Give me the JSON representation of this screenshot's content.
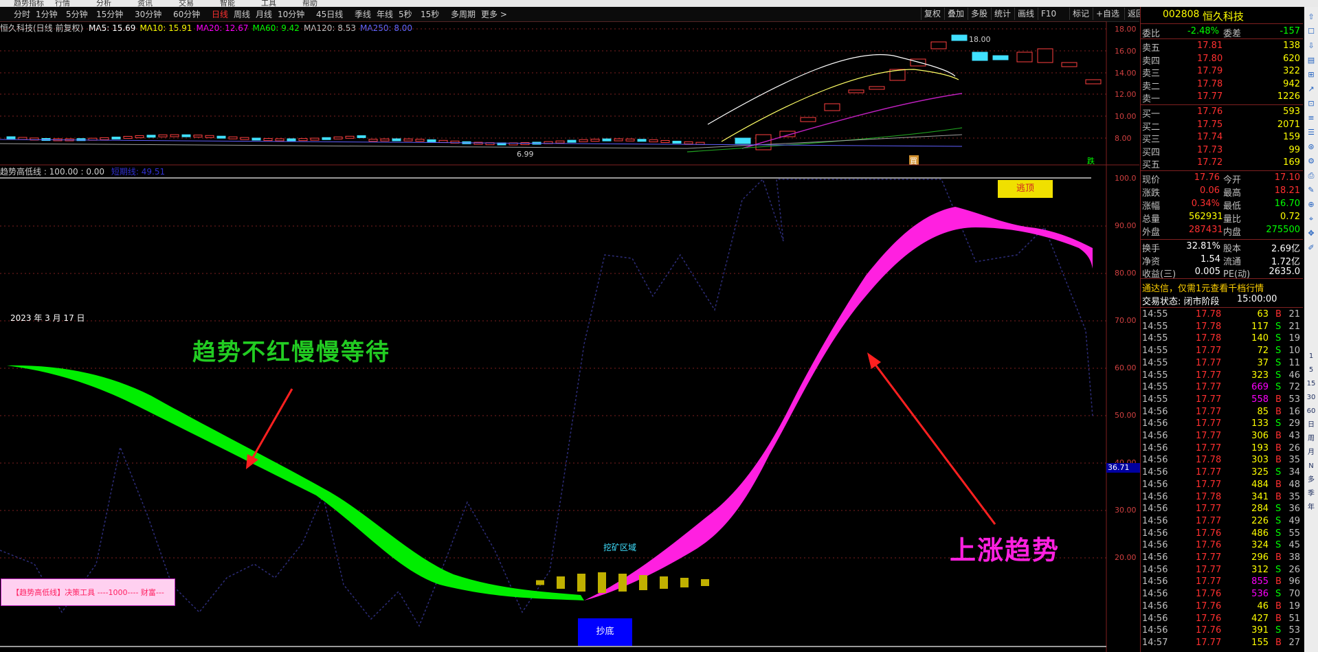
{
  "titlebar": {
    "items": [
      "趋势指标",
      "行情",
      "分析",
      "资讯",
      "交易",
      "智能",
      "工具",
      "帮助"
    ]
  },
  "toolbar": {
    "periods": [
      "分时",
      "1分钟",
      "5分钟",
      "15分钟",
      "30分钟",
      "60分钟",
      "日线",
      "周线",
      "月线",
      "10分钟",
      "45日线",
      "季线",
      "年线",
      "5秒",
      "15秒",
      "多周期",
      "更多 >"
    ],
    "active_period": "日线",
    "right_buttons": [
      "复权",
      "叠加",
      "多股",
      "统计",
      "画线",
      "F10",
      "标记",
      "+自选",
      "返回"
    ]
  },
  "main_chart": {
    "stock_label": "恒久科技(日线 前复权)",
    "ma_items": [
      {
        "label": "MA5: 15.69",
        "color": "#ffffff"
      },
      {
        "label": "MA10: 15.91",
        "color": "#ffff00"
      },
      {
        "label": "MA20: 12.67",
        "color": "#ff00ff"
      },
      {
        "label": "MA60: 9.42",
        "color": "#00ff00"
      },
      {
        "label": "MA120: 8.53",
        "color": "#c0c0c0"
      },
      {
        "label": "MA250: 8.00",
        "color": "#6666ff"
      }
    ],
    "price_axis": [
      "18.00",
      "16.00",
      "14.00",
      "12.00",
      "10.00",
      "8.00"
    ],
    "high_label": "18.00",
    "low_label": "6.99",
    "marker_buy": "買",
    "marker_sell": "跌"
  },
  "indicator": {
    "title": "趋势高低线 : 100.00 : 0.00",
    "extra": "短期线: 49.51",
    "axis": [
      "100.0",
      "90.00",
      "80.00",
      "70.00",
      "60.00",
      "50.00",
      "40.00",
      "30.00",
      "20.00"
    ],
    "current_value": "36.71",
    "date_label": "2023 年 3 月 17 日",
    "annotation_wait": "趋势不红慢慢等待",
    "annotation_up": "上涨趋势",
    "tag_escape": "逃顶",
    "tag_bottom": "抄底",
    "tag_mining": "挖矿区域",
    "footer_banner": "【趋势高低线】决策工具 ----1000---- 财富---"
  },
  "quote_panel": {
    "code": "002808",
    "name": "恒久科技",
    "weibi_label": "委比",
    "weibi_value": "-2.48%",
    "weicha_label": "委差",
    "weicha_value": "-157",
    "asks": [
      {
        "label": "卖五",
        "price": "17.81",
        "vol": "138"
      },
      {
        "label": "卖四",
        "price": "17.80",
        "vol": "620"
      },
      {
        "label": "卖三",
        "price": "17.79",
        "vol": "322"
      },
      {
        "label": "卖二",
        "price": "17.78",
        "vol": "942"
      },
      {
        "label": "卖一",
        "price": "17.77",
        "vol": "1226"
      }
    ],
    "bids": [
      {
        "label": "买一",
        "price": "17.76",
        "vol": "593"
      },
      {
        "label": "买二",
        "price": "17.75",
        "vol": "2071"
      },
      {
        "label": "买三",
        "price": "17.74",
        "vol": "159"
      },
      {
        "label": "买四",
        "price": "17.73",
        "vol": "99"
      },
      {
        "label": "买五",
        "price": "17.72",
        "vol": "169"
      }
    ],
    "stats": [
      {
        "l1": "现价",
        "v1": "17.76",
        "c1": "#ff3030",
        "l2": "今开",
        "v2": "17.10",
        "c2": "#ff3030"
      },
      {
        "l1": "涨跌",
        "v1": "0.06",
        "c1": "#ff3030",
        "l2": "最高",
        "v2": "18.21",
        "c2": "#ff3030"
      },
      {
        "l1": "涨幅",
        "v1": "0.34%",
        "c1": "#ff3030",
        "l2": "最低",
        "v2": "16.70",
        "c2": "#00ff00"
      },
      {
        "l1": "总量",
        "v1": "562931",
        "c1": "#ffff00",
        "l2": "量比",
        "v2": "0.72",
        "c2": "#ffff00"
      },
      {
        "l1": "外盘",
        "v1": "287431",
        "c1": "#ff3030",
        "l2": "内盘",
        "v2": "275500",
        "c2": "#00ff00"
      }
    ],
    "stats2": [
      {
        "l1": "换手",
        "v1": "32.81%",
        "l2": "股本",
        "v2": "2.69亿"
      },
      {
        "l1": "净资",
        "v1": "1.54",
        "l2": "流通",
        "v2": "1.72亿"
      },
      {
        "l1": "收益(三)",
        "v1": "0.005",
        "l2": "PE(动)",
        "v2": "2635.0"
      }
    ],
    "promo": "通达信，仅需1元查看千档行情",
    "trade_status_label": "交易状态: 闭市阶段",
    "trade_status_time": "15:00:00",
    "ticks": [
      {
        "t": "14:55",
        "p": "17.78",
        "v": "63",
        "s": "B",
        "n": "21"
      },
      {
        "t": "14:55",
        "p": "17.78",
        "v": "117",
        "s": "S",
        "n": "21"
      },
      {
        "t": "14:55",
        "p": "17.78",
        "v": "140",
        "s": "S",
        "n": "19"
      },
      {
        "t": "14:55",
        "p": "17.77",
        "v": "72",
        "s": "S",
        "n": "10"
      },
      {
        "t": "14:55",
        "p": "17.77",
        "v": "37",
        "s": "S",
        "n": "11"
      },
      {
        "t": "14:55",
        "p": "17.77",
        "v": "323",
        "s": "S",
        "n": "46"
      },
      {
        "t": "14:55",
        "p": "17.77",
        "v": "669",
        "s": "S",
        "n": "72"
      },
      {
        "t": "14:55",
        "p": "17.77",
        "v": "558",
        "s": "B",
        "n": "53"
      },
      {
        "t": "14:56",
        "p": "17.77",
        "v": "85",
        "s": "B",
        "n": "16"
      },
      {
        "t": "14:56",
        "p": "17.77",
        "v": "133",
        "s": "S",
        "n": "29"
      },
      {
        "t": "14:56",
        "p": "17.77",
        "v": "306",
        "s": "B",
        "n": "43"
      },
      {
        "t": "14:56",
        "p": "17.77",
        "v": "193",
        "s": "B",
        "n": "26"
      },
      {
        "t": "14:56",
        "p": "17.78",
        "v": "303",
        "s": "B",
        "n": "35"
      },
      {
        "t": "14:56",
        "p": "17.77",
        "v": "325",
        "s": "S",
        "n": "34"
      },
      {
        "t": "14:56",
        "p": "17.77",
        "v": "484",
        "s": "B",
        "n": "48"
      },
      {
        "t": "14:56",
        "p": "17.78",
        "v": "341",
        "s": "B",
        "n": "35"
      },
      {
        "t": "14:56",
        "p": "17.77",
        "v": "284",
        "s": "S",
        "n": "36"
      },
      {
        "t": "14:56",
        "p": "17.77",
        "v": "226",
        "s": "S",
        "n": "49"
      },
      {
        "t": "14:56",
        "p": "17.76",
        "v": "486",
        "s": "S",
        "n": "55"
      },
      {
        "t": "14:56",
        "p": "17.76",
        "v": "324",
        "s": "S",
        "n": "45"
      },
      {
        "t": "14:56",
        "p": "17.77",
        "v": "296",
        "s": "B",
        "n": "38"
      },
      {
        "t": "14:56",
        "p": "17.77",
        "v": "312",
        "s": "S",
        "n": "26"
      },
      {
        "t": "14:56",
        "p": "17.77",
        "v": "855",
        "s": "B",
        "n": "96"
      },
      {
        "t": "14:56",
        "p": "17.76",
        "v": "536",
        "s": "S",
        "n": "70"
      },
      {
        "t": "14:56",
        "p": "17.76",
        "v": "46",
        "s": "B",
        "n": "19"
      },
      {
        "t": "14:56",
        "p": "17.76",
        "v": "427",
        "s": "B",
        "n": "51"
      },
      {
        "t": "14:56",
        "p": "17.76",
        "v": "391",
        "s": "S",
        "n": "53"
      },
      {
        "t": "14:57",
        "p": "17.77",
        "v": "155",
        "s": "B",
        "n": "27"
      }
    ]
  },
  "sidebar": {
    "items": [
      "1",
      "5",
      "15",
      "30",
      "60",
      "日",
      "周",
      "月",
      "N",
      "多",
      "季",
      "年"
    ]
  }
}
